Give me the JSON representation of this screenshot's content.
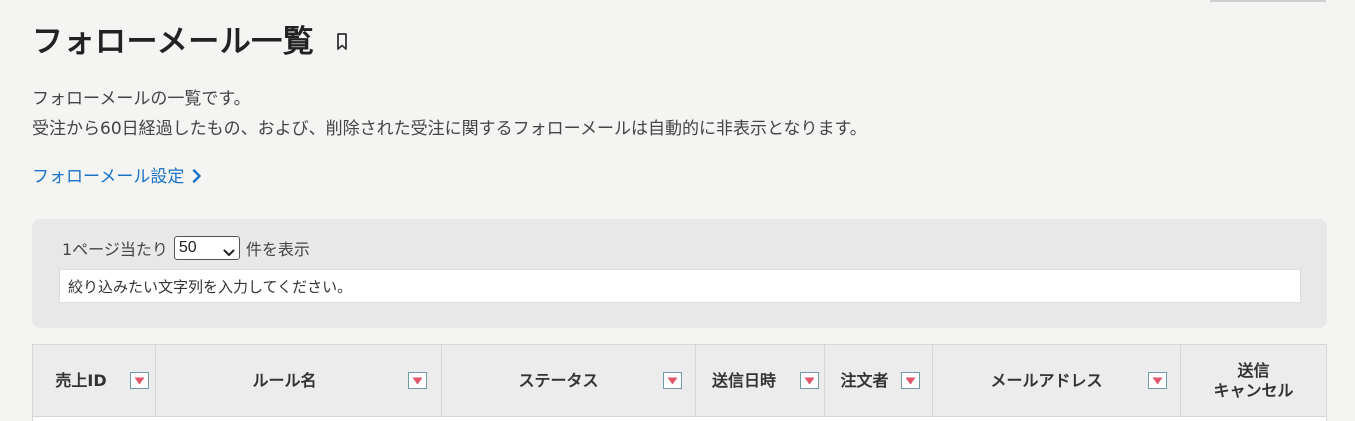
{
  "page": {
    "title": "フォローメール一覧",
    "description_line1": "フォローメールの一覧です。",
    "description_line2": "受注から60日経過したもの、および、削除された受注に関するフォローメールは自動的に非表示となります。",
    "settings_link": "フォローメール設定"
  },
  "filter": {
    "per_page_prefix": "1ページ当たり",
    "per_page_value": "50",
    "per_page_suffix": "件を表示",
    "search_placeholder": "絞り込みたい文字列を入力してください。"
  },
  "table": {
    "columns": [
      {
        "label": "売上ID",
        "sortable": true
      },
      {
        "label": "ルール名",
        "sortable": true
      },
      {
        "label": "ステータス",
        "sortable": true
      },
      {
        "label": "送信日時",
        "sortable": true
      },
      {
        "label": "注文者",
        "sortable": true
      },
      {
        "label": "メールアドレス",
        "sortable": true
      },
      {
        "label": "送信\nキャンセル",
        "sortable": false
      }
    ]
  },
  "icons": {
    "bookmark": "bookmark-icon",
    "chevron": "chevron-right-icon",
    "sort": "sort-down-icon"
  },
  "colors": {
    "link": "#1a73c8",
    "sort_arrow": "#e0566b",
    "sort_border": "#6f9aa6"
  }
}
